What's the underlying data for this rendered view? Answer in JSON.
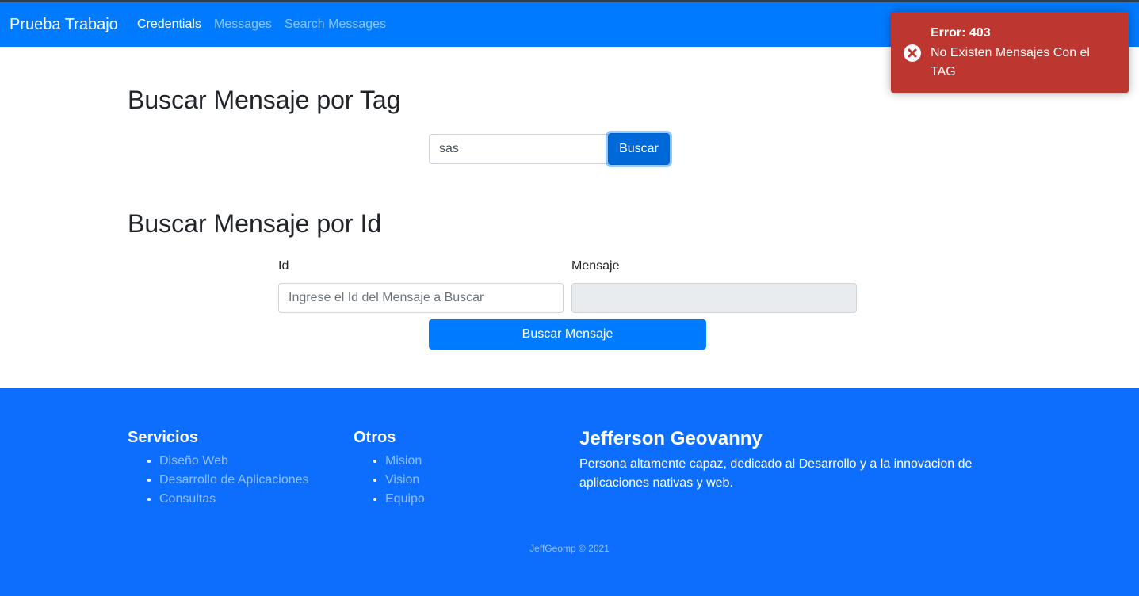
{
  "navbar": {
    "brand": "Prueba Trabajo",
    "links": [
      {
        "label": "Credentials",
        "active": true
      },
      {
        "label": "Messages",
        "active": false
      },
      {
        "label": "Search Messages",
        "active": false
      }
    ]
  },
  "tag_search": {
    "title": "Buscar Mensaje por Tag",
    "input_value": "sas",
    "button_label": "Buscar"
  },
  "id_search": {
    "title": "Buscar Mensaje por Id",
    "id_label": "Id",
    "id_placeholder": "Ingrese el Id del Mensaje a Buscar",
    "message_label": "Mensaje",
    "message_value": "",
    "button_label": "Buscar Mensaje"
  },
  "footer": {
    "services": {
      "title": "Servicios",
      "items": [
        "Diseño Web",
        "Desarrollo de Aplicaciones",
        "Consultas"
      ]
    },
    "others": {
      "title": "Otros",
      "items": [
        "Mision",
        "Vision",
        "Equipo"
      ]
    },
    "about": {
      "title": "Jefferson Geovanny",
      "description": "Persona altamente capaz, dedicado al Desarrollo y a la innovacion de aplicaciones nativas y web."
    },
    "copyright": "JeffGeomp © 2021"
  },
  "toast": {
    "title": "Error: 403",
    "message": "No Existen Mensajes Con el TAG",
    "icon": "error-circle-icon"
  },
  "colors": {
    "primary": "#007bff",
    "footer": "#0d6efd",
    "error": "#bd362f"
  }
}
